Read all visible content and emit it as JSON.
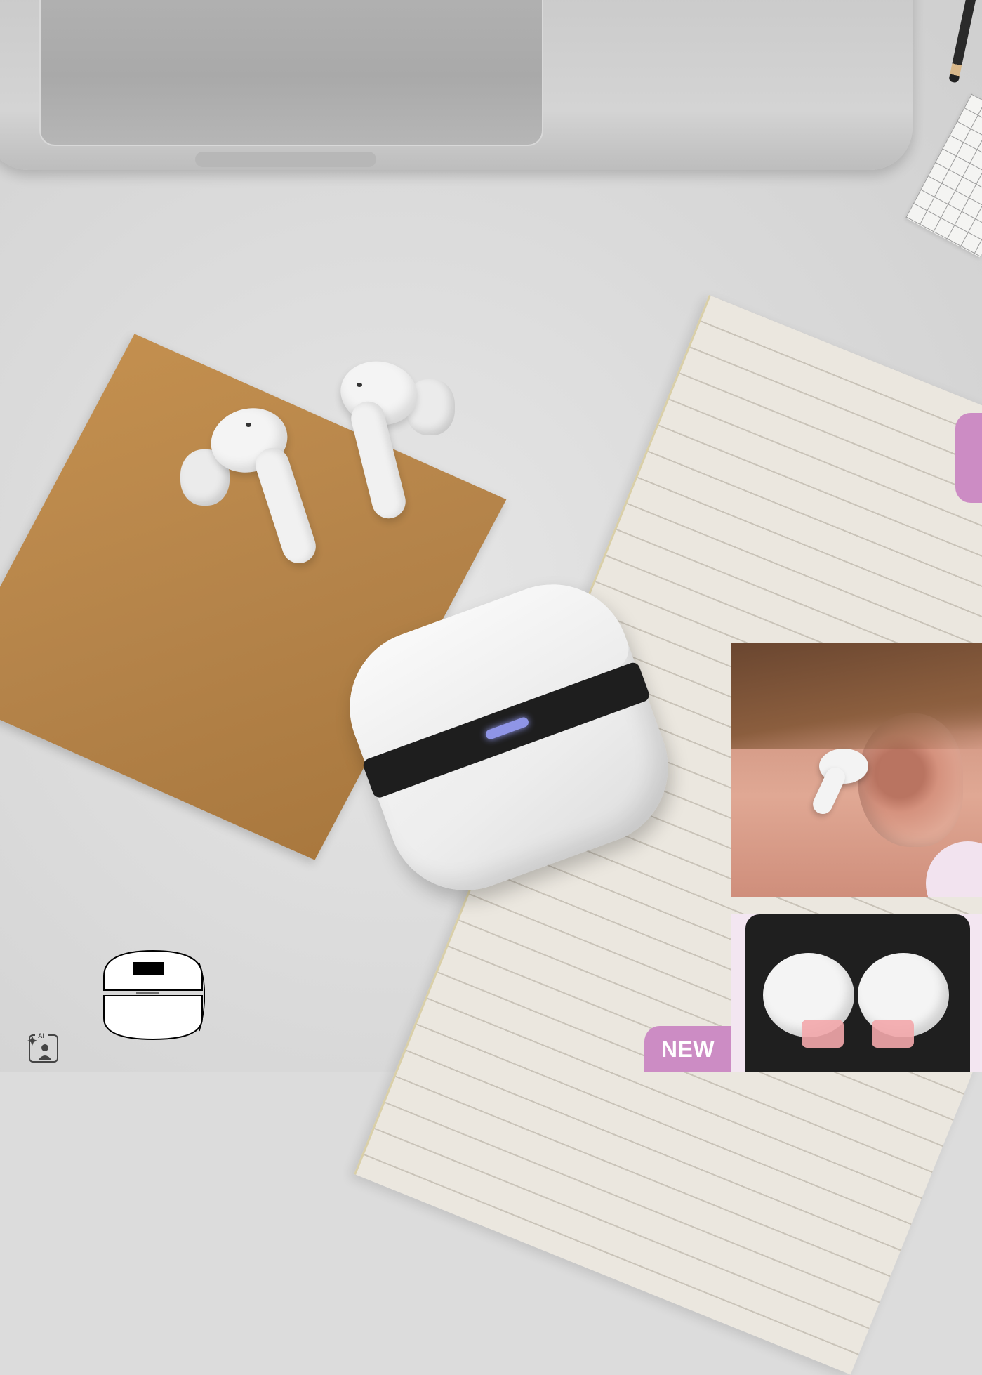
{
  "badge": {
    "label": "NEW"
  },
  "icons": {
    "case_outline": "earbuds-case-outline-icon",
    "ai_generated": "ai-image-icon",
    "ai_icon_text": "AI"
  },
  "colors": {
    "accent_pink": "#cc8cc4",
    "led_blue": "#8f95e6",
    "kraft": "#b5844a"
  }
}
